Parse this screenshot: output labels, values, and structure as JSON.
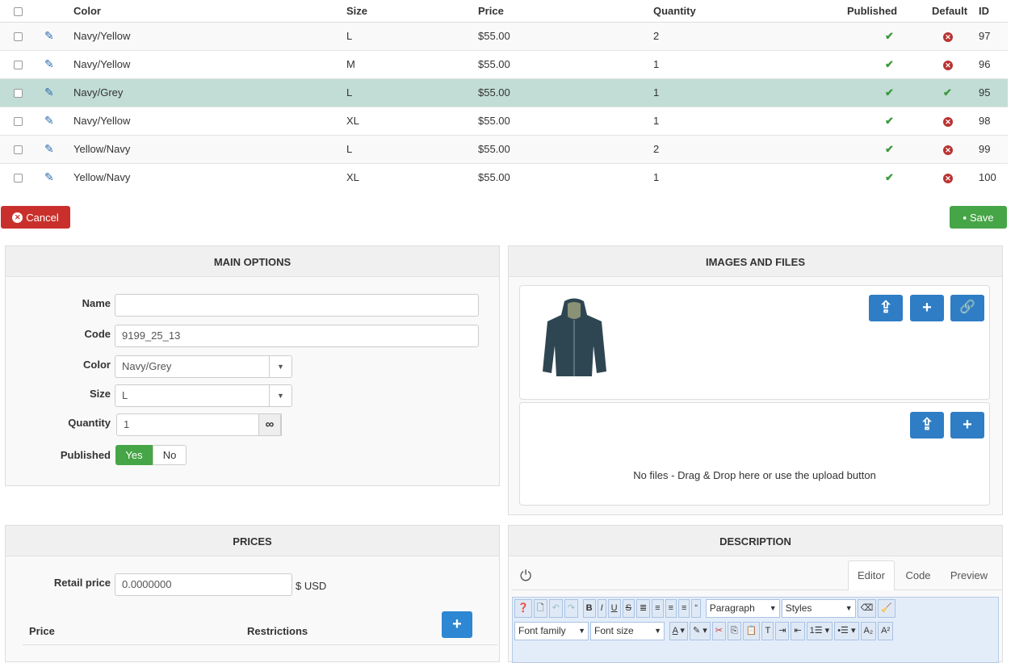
{
  "table": {
    "headers": {
      "color": "Color",
      "size": "Size",
      "price": "Price",
      "quantity": "Quantity",
      "published": "Published",
      "default": "Default",
      "id": "ID"
    },
    "rows": [
      {
        "color": "Navy/Yellow",
        "size": "L",
        "price": "$55.00",
        "quantity": "2",
        "published": true,
        "default": false,
        "id": "97"
      },
      {
        "color": "Navy/Yellow",
        "size": "M",
        "price": "$55.00",
        "quantity": "1",
        "published": true,
        "default": false,
        "id": "96"
      },
      {
        "color": "Navy/Grey",
        "size": "L",
        "price": "$55.00",
        "quantity": "1",
        "published": true,
        "default": true,
        "id": "95"
      },
      {
        "color": "Navy/Yellow",
        "size": "XL",
        "price": "$55.00",
        "quantity": "1",
        "published": true,
        "default": false,
        "id": "98"
      },
      {
        "color": "Yellow/Navy",
        "size": "L",
        "price": "$55.00",
        "quantity": "2",
        "published": true,
        "default": false,
        "id": "99"
      },
      {
        "color": "Yellow/Navy",
        "size": "XL",
        "price": "$55.00",
        "quantity": "1",
        "published": true,
        "default": false,
        "id": "100"
      }
    ]
  },
  "actions": {
    "cancel": "Cancel",
    "save": "Save"
  },
  "main": {
    "title": "MAIN OPTIONS",
    "name_label": "Name",
    "name_value": "",
    "code_label": "Code",
    "code_value": "9199_25_13",
    "color_label": "Color",
    "color_value": "Navy/Grey",
    "size_label": "Size",
    "size_value": "L",
    "quantity_label": "Quantity",
    "quantity_value": "1",
    "published_label": "Published",
    "yes": "Yes",
    "no": "No"
  },
  "images": {
    "title": "IMAGES AND FILES",
    "no_files": "No files - Drag & Drop here or use the upload button"
  },
  "prices": {
    "title": "PRICES",
    "retail_label": "Retail price",
    "retail_value": "0.0000000",
    "currency": "$ USD",
    "col_price": "Price",
    "col_restrictions": "Restrictions"
  },
  "description": {
    "title": "DESCRIPTION",
    "tabs": [
      "Editor",
      "Code",
      "Preview"
    ],
    "format": "Paragraph",
    "styles": "Styles",
    "font_family": "Font family",
    "font_size": "Font size"
  }
}
